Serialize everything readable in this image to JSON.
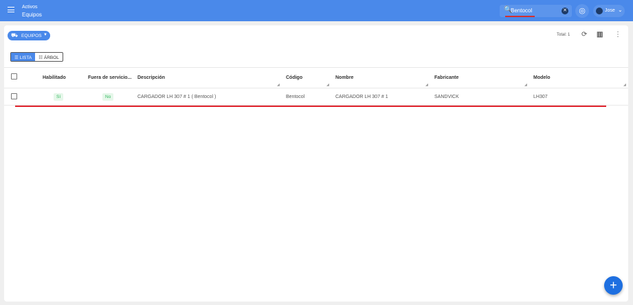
{
  "header": {
    "breadcrumb_parent": "Activos",
    "breadcrumb_current": "Equipos",
    "search_value": "Bentocol",
    "user_name": "Jose"
  },
  "toolbar": {
    "entity_selector": "EQUIPOS",
    "total": "Total: 1",
    "view_list": "LISTA",
    "view_tree": "ÁRBOL"
  },
  "table": {
    "columns": [
      "Habilitado",
      "Fuera de servicio...",
      "Descripción",
      "Código",
      "Nombre",
      "Fabricante",
      "Modelo"
    ],
    "rows": [
      {
        "habilitado": "Sí",
        "fuera": "No",
        "descripcion": "CARGADOR LH 307 # 1 ( Bentocol )",
        "codigo": "Bentocol",
        "nombre": "CARGADOR LH 307 # 1",
        "fabricante": "SANDVICK",
        "modelo": "LH307"
      }
    ]
  },
  "fab": {
    "label": "+"
  }
}
